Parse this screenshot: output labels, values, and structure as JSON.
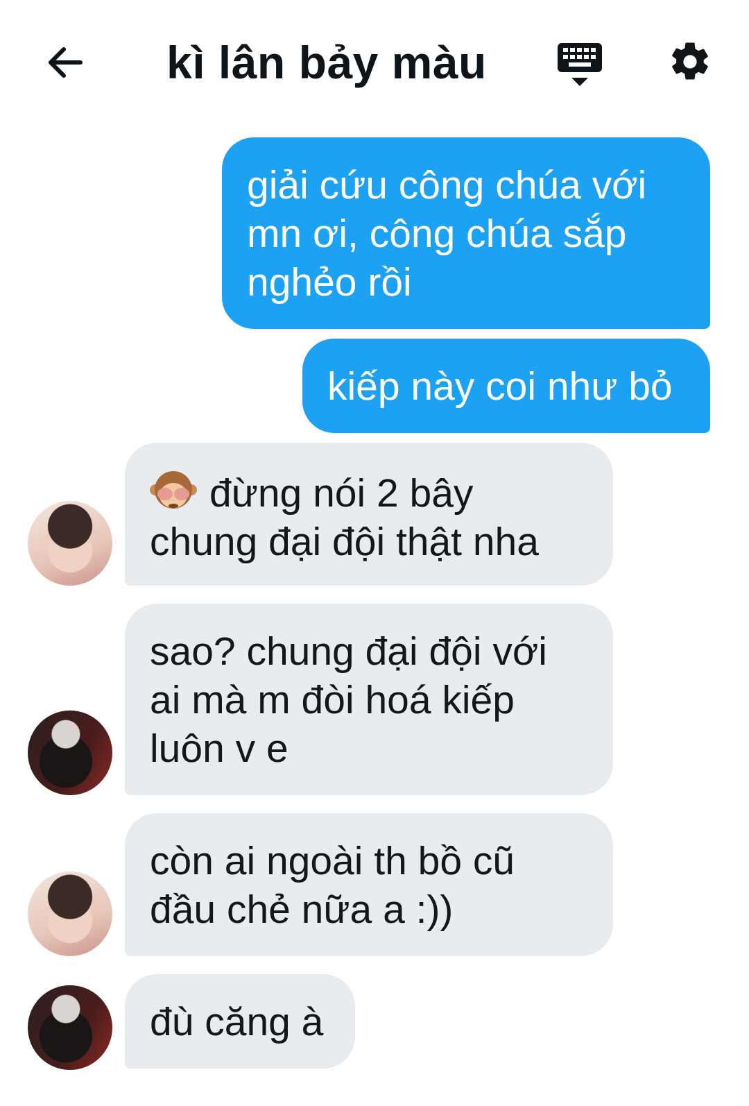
{
  "header": {
    "title": "kì lân bảy màu",
    "back_icon": "arrow-left-icon",
    "keyboard_icon": "keyboard-icon",
    "settings_icon": "gear-icon"
  },
  "colors": {
    "outgoing_bubble": "#1da1f2",
    "incoming_bubble": "#e8ecef"
  },
  "messages": [
    {
      "direction": "out",
      "text": "giải cứu công chúa với mn ơi, công chúa sắp nghẻo rồi"
    },
    {
      "direction": "out",
      "text": "kiếp này coi như bỏ"
    },
    {
      "direction": "in",
      "avatar": "avatar-1",
      "emoji": "see-no-evil-monkey-icon",
      "text": "đừng nói 2 bây chung đại đội thật nha"
    },
    {
      "direction": "in",
      "avatar": "avatar-2",
      "text": "sao? chung đại đội với ai mà m đòi hoá kiếp luôn v e"
    },
    {
      "direction": "in",
      "avatar": "avatar-1",
      "text": "còn ai ngoài th bồ cũ đầu chẻ nữa a :))"
    },
    {
      "direction": "in",
      "avatar": "avatar-2",
      "text": "đù căng à"
    }
  ]
}
